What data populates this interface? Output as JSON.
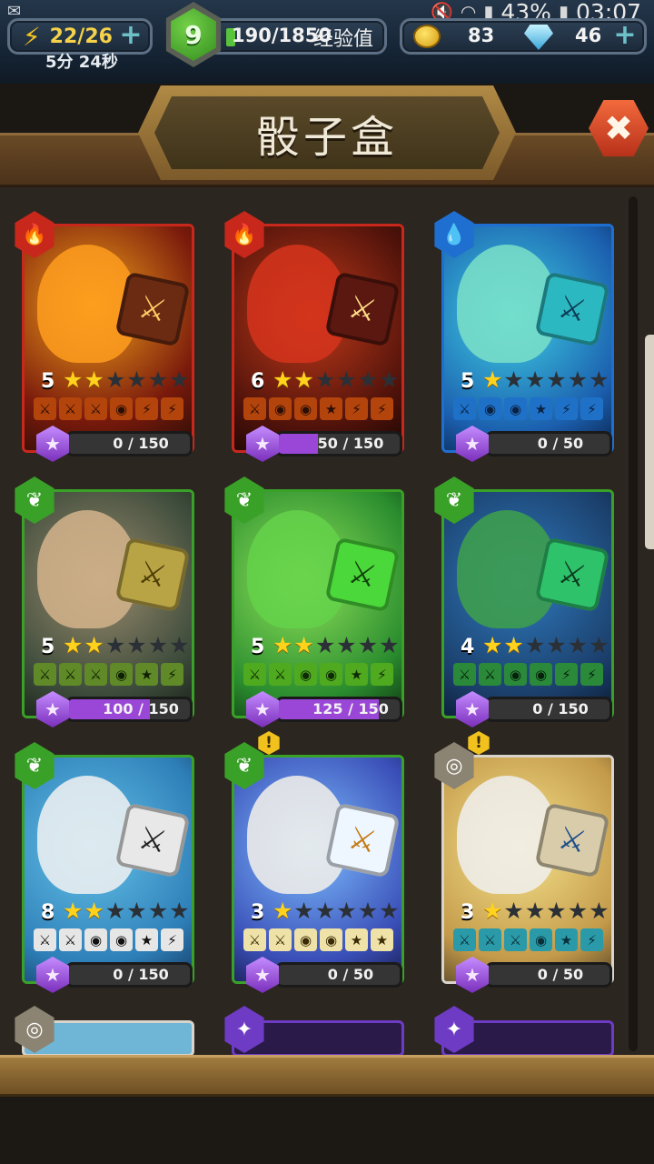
{
  "status_bar": {
    "battery": "43%",
    "time": "03:07",
    "left_icon": "wechat-icon",
    "right_icons": [
      "mute-icon",
      "wifi-icon",
      "signal-icon",
      "battery-icon"
    ]
  },
  "resources": {
    "energy": "22/26",
    "energy_timer": "5分 24秒",
    "level": "9",
    "xp": "190/1850",
    "xp_label": "经验值",
    "gold": "83",
    "gems": "46"
  },
  "header": {
    "title": "骰子盒"
  },
  "colors": {
    "fire": "#c7281b",
    "water": "#1f6fd0",
    "nature": "#3aa128",
    "neutral": "#8c8473",
    "arcane": "#6d3bc4",
    "progress_fill": "#9a47d8"
  },
  "cards": [
    {
      "name": "fire-monster",
      "element": "fire",
      "level": "5",
      "stars": 2,
      "faces": [
        "sword",
        "sword",
        "sword",
        "shield",
        "bolt",
        "bolt"
      ],
      "progress": "0 / 150",
      "progress_pct": 0,
      "alert": false
    },
    {
      "name": "lava-crab",
      "element": "fire",
      "level": "6",
      "stars": 2,
      "faces": [
        "sword",
        "shield",
        "shield",
        "star",
        "bolt",
        "bolt"
      ],
      "progress": "50 / 150",
      "progress_pct": 33,
      "alert": false
    },
    {
      "name": "water-dragon",
      "element": "water",
      "level": "5",
      "stars": 1,
      "faces": [
        "sword",
        "shield",
        "shield",
        "star",
        "bolt",
        "bolt"
      ],
      "progress": "0 / 50",
      "progress_pct": 0,
      "alert": false
    },
    {
      "name": "dwarf-warrior",
      "element": "nature",
      "level": "5",
      "stars": 2,
      "faces": [
        "sword",
        "sword",
        "sword",
        "shield",
        "star",
        "bolt"
      ],
      "progress": "100 / 150",
      "progress_pct": 67,
      "alert": false
    },
    {
      "name": "slime-pyramid",
      "element": "nature",
      "level": "5",
      "stars": 2,
      "faces": [
        "sword",
        "sword",
        "shield",
        "shield",
        "star",
        "bolt"
      ],
      "progress": "125 / 150",
      "progress_pct": 83,
      "alert": false
    },
    {
      "name": "hydra",
      "element": "nature",
      "level": "4",
      "stars": 2,
      "faces": [
        "sword",
        "sword",
        "shield",
        "shield",
        "bolt",
        "bolt"
      ],
      "progress": "0 / 150",
      "progress_pct": 0,
      "alert": false
    },
    {
      "name": "panda",
      "element": "nature",
      "level": "8",
      "stars": 2,
      "faces": [
        "sword",
        "sword",
        "shield",
        "shield",
        "star",
        "bolt"
      ],
      "progress": "0 / 150",
      "progress_pct": 0,
      "alert": false
    },
    {
      "name": "unicorn",
      "element": "nature",
      "level": "3",
      "stars": 1,
      "faces": [
        "sword",
        "sword",
        "shield",
        "shield",
        "star",
        "star"
      ],
      "progress": "0 / 50",
      "progress_pct": 0,
      "alert": true
    },
    {
      "name": "griffin",
      "element": "neutral",
      "level": "3",
      "stars": 1,
      "faces": [
        "sword",
        "sword",
        "sword",
        "shield",
        "star",
        "bolt"
      ],
      "progress": "0 / 50",
      "progress_pct": 0,
      "alert": true
    }
  ],
  "partial_row": [
    {
      "element": "neutral"
    },
    {
      "element": "arcane"
    },
    {
      "element": "arcane"
    }
  ]
}
